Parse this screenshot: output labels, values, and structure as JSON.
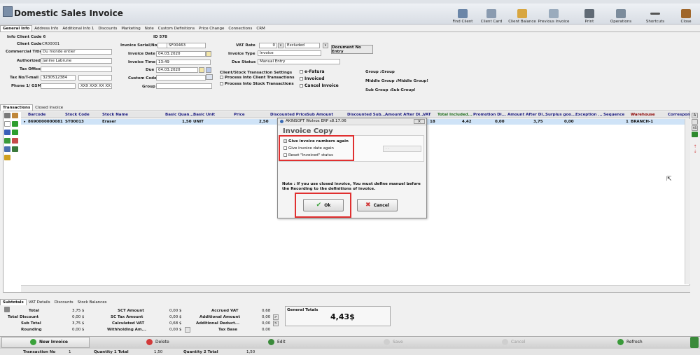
{
  "app": {
    "title": "Domestic Sales Invoice"
  },
  "toolbar": [
    {
      "label": "Find Client",
      "icon": "find-client-icon"
    },
    {
      "label": "Client Card",
      "icon": "client-card-icon"
    },
    {
      "label": "Client Balance",
      "icon": "client-balance-icon"
    },
    {
      "label": "Previous Invoice",
      "icon": "previous-invoice-icon"
    },
    {
      "label": "Print",
      "icon": "printer-icon"
    },
    {
      "label": "Operations",
      "icon": "operations-icon"
    },
    {
      "label": "Shortcuts",
      "icon": "shortcuts-icon"
    },
    {
      "label": "Close",
      "icon": "close-door-icon"
    }
  ],
  "tabs": [
    "General Info",
    "Address Info",
    "Additional Info 1",
    "Discounts",
    "Marketing",
    "Note",
    "Custom Definitions",
    "Price Change",
    "Connections",
    "CRM"
  ],
  "form": {
    "info_client_code_label": "Info Client Code 6",
    "client_code_label": "Client Code",
    "client_code": "CR00001",
    "commercial_title_label": "Commercial Title",
    "commercial_title": "Du monde entier",
    "authorized_label": "Authorized",
    "authorized": "Janine Labrune",
    "tax_office_label": "Tax Office",
    "tax_no_label": "Tax No/T-mail",
    "tax_no": "3230512384",
    "phone_label": "Phone 1/ GSM",
    "phone_mask": "XXX XXX XX XX",
    "id_label": "ID 578",
    "serial_label": "Invoice Serial/No",
    "serial": "SF00463",
    "date_label": "Invoice Date",
    "date": "04.03.2020",
    "time_label": "Invoice Time",
    "time": "13:49",
    "due_label": "Due",
    "due": "04.03.2020",
    "custom_code_label": "Custom Code",
    "group_label": "Group",
    "vat_rate_label": "VAT Rate",
    "vat_rate": "0",
    "vat_mode": "Excluded",
    "invoice_type_label": "Invoice Type",
    "invoice_type": "Invoice",
    "due_status_label": "Due Status",
    "due_status": "Manual Entry",
    "doc_no_entry": "Document No Entry",
    "client_stock_label": "Client/Stock Transaction Settings",
    "process_client": "Process Into Client Transactions",
    "process_stock": "Process Into Stock Transactions",
    "efatura": "e-Fatura",
    "invoiced": "Invoiced",
    "cancel_invoice": "Cancel Invoice",
    "group_info": "Group :Group",
    "middle_group_info": "Middle Group :Middle Group!",
    "sub_group_info": "Sub Group :Sub Group!"
  },
  "subtabs": [
    "Transactions",
    "Closed Invoice"
  ],
  "grid": {
    "headers": [
      "Barcode",
      "Stock Code",
      "Stock Name",
      "Basic Quan...",
      "Basic Unit",
      "Price",
      "Discounted Price",
      "Sub Amount",
      "Discounted Sub...",
      "Amount After Di...",
      "VAT",
      "Total Included...",
      "Promotion Di...",
      "Amount After Di...",
      "Surplus goo...",
      "Exception ...",
      "Sequence",
      "Warehouse",
      "Correspon"
    ],
    "row": [
      "8690000000081",
      "ST00013",
      "Eraser",
      "1,50",
      "UNIT",
      "2,50",
      "18",
      "4,42",
      "0,00",
      "3,75",
      "0,00",
      "1",
      "BRANCH-1"
    ]
  },
  "dialog": {
    "window_title": "AKINSOFT Wolvox ERP s8.17.06",
    "heading": "Invoice Copy",
    "options": [
      "Give invoice numbers again",
      "Give invoice date again",
      "Reset \"Invoiced\" status"
    ],
    "date_field": ". .",
    "note": "Note : If you use closed invoice, You must define manuel before the Recording to the definitions of invoice.",
    "ok": "Ok",
    "cancel": "Cancel"
  },
  "totals_tabs": [
    "Subtotals",
    "VAT Details",
    "Discounts",
    "Stock Balances"
  ],
  "totals": {
    "total_label": "Total",
    "total": "3,75 $",
    "total_discount_label": "Total Discount",
    "total_discount": "0,00 $",
    "sub_total_label": "Sub Total",
    "sub_total": "3,75 $",
    "rounding_label": "Rounding",
    "rounding": "0,00 $",
    "sct_label": "SCT Amount",
    "sct": "0,00 $",
    "sc_tax_label": "SC Tax Amount",
    "sc_tax": "0,00 $",
    "calc_vat_label": "Calculated VAT",
    "calc_vat": "0,68 $",
    "withholding_label": "Withholding Am...",
    "withholding": "0,00 $",
    "accrued_vat_label": "Accrued VAT",
    "accrued_vat": "0,68",
    "additional_amount_label": "Additional Amount",
    "additional_amount": "0,00",
    "additional_deduct_label": "Additional Deduct...",
    "additional_deduct": "0,00",
    "tax_base_label": "Tax Base",
    "tax_base": "0,00",
    "general_totals_label": "General Totals",
    "general_totals": "4,43$"
  },
  "actions": [
    "New Invoice",
    "Delete",
    "Edit",
    "Save",
    "Cancel",
    "Refresh"
  ],
  "status": {
    "transaction_no_label": "Transaction No",
    "transaction_no": "1",
    "qty1_label": "Quantity 1 Total",
    "qty1": "1,50",
    "qty2_label": "Quantity 2 Total",
    "qty2": "1,50"
  },
  "colors": {
    "accent_red": "#e03030",
    "selected_row": "#cfe3f7",
    "warehouse_header": "#8b0000"
  }
}
